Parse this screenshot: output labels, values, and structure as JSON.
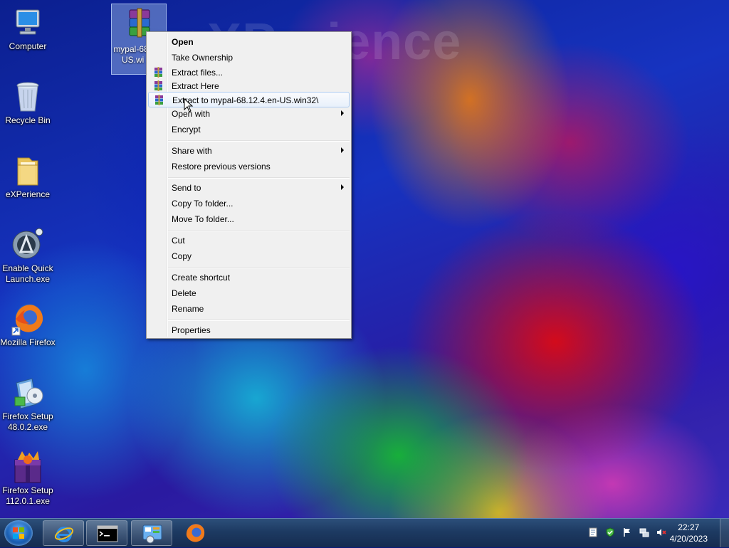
{
  "desktop": {
    "watermark": "eXPerience",
    "icons": [
      {
        "label": "Computer",
        "icon": "computer-icon"
      },
      {
        "label": "Recycle Bin",
        "icon": "recycle-bin-icon"
      },
      {
        "label": "eXPerience",
        "icon": "folder-icon"
      },
      {
        "label": "Enable Quick Launch.exe",
        "icon": "quick-launch-icon"
      },
      {
        "label": "Mozilla Firefox",
        "icon": "firefox-icon"
      },
      {
        "label": "Firefox Setup 48.0.2.exe",
        "icon": "installer-icon"
      },
      {
        "label": "Firefox Setup 112.0.1.exe",
        "icon": "installer-icon"
      }
    ],
    "selected_file": {
      "label": "mypal-68 .en-US.wi zip",
      "icon": "winrar-archive-icon"
    }
  },
  "context_menu": {
    "items": [
      {
        "label": "Open",
        "bold": true
      },
      {
        "label": "Take Ownership"
      },
      {
        "label": "Extract files...",
        "icon": "winrar-icon"
      },
      {
        "label": "Extract Here",
        "icon": "winrar-icon"
      },
      {
        "label": "Extract to mypal-68.12.4.en-US.win32\\",
        "icon": "winrar-icon",
        "hover": true
      },
      {
        "label": "Open with",
        "submenu": true
      },
      {
        "label": "Encrypt"
      },
      {
        "label": "Share with",
        "submenu": true
      },
      {
        "label": "Restore previous versions"
      },
      {
        "label": "Send to",
        "submenu": true
      },
      {
        "label": "Copy To folder..."
      },
      {
        "label": "Move To folder..."
      },
      {
        "label": "Cut"
      },
      {
        "label": "Copy"
      },
      {
        "label": "Create shortcut"
      },
      {
        "label": "Delete"
      },
      {
        "label": "Rename"
      },
      {
        "label": "Properties"
      }
    ]
  },
  "taskbar": {
    "buttons": [
      "internet-explorer-icon",
      "command-prompt-icon",
      "control-panel-icon",
      "firefox-icon"
    ],
    "clock": {
      "time": "22:27",
      "date": "4/20/2023"
    }
  }
}
